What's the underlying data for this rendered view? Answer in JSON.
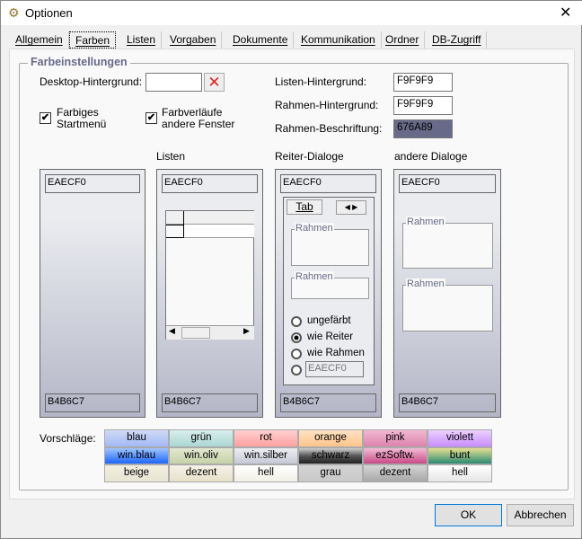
{
  "window": {
    "title": "Optionen",
    "close": "✕"
  },
  "tabs": [
    "Allgemein",
    "Farben",
    "Listen",
    "Vorgaben",
    "Dokumente",
    "Kommunikation",
    "Ordner",
    "DB-Zugriff"
  ],
  "group": {
    "title": "Farbeinstellungen"
  },
  "desktop": {
    "label": "Desktop-Hintergrund:",
    "value": "",
    "clear": "✕"
  },
  "checks": {
    "colored_start": "Farbiges Startmenü",
    "gradients": "Farbverläufe andere Fenster"
  },
  "listen_bg": {
    "label": "Listen-Hintergrund:",
    "value": "F9F9F9"
  },
  "rahmen_bg": {
    "label": "Rahmen-Hintergrund:",
    "value": "F9F9F9"
  },
  "rahmen_caption": {
    "label": "Rahmen-Beschriftung:",
    "value": "676A89",
    "color": "#676A89"
  },
  "columns": {
    "listen": "Listen",
    "reiter": "Reiter-Dialoge",
    "andere": "andere Dialoge",
    "top": "EAECF0",
    "bottom": "B4B6C7"
  },
  "preview": {
    "tab": "Tab",
    "frame": "Rahmen",
    "radios": [
      "ungefärbt",
      "wie Reiter",
      "wie Rahmen"
    ],
    "custom": "EAECF0"
  },
  "suggestions": {
    "label": "Vorschläge:",
    "items": [
      [
        "blau",
        "#cfdaf5",
        "#a3b8f5"
      ],
      [
        "grün",
        "#d9efed",
        "#aad7d2"
      ],
      [
        "rot",
        "#ffd0d0",
        "#ffa0a0"
      ],
      [
        "orange",
        "#ffe2c4",
        "#ffc48a"
      ],
      [
        "pink",
        "#f2b8d2",
        "#dc82ad"
      ],
      [
        "violett",
        "#ecd2ff",
        "#c88cff"
      ],
      [
        "win.blau",
        "#9fc4ff",
        "#1c66ff"
      ],
      [
        "win.oliv",
        "#e2e8d0",
        "#c6d2a8"
      ],
      [
        "win.silber",
        "#eeeef2",
        "#c6c8d6"
      ],
      [
        "schwarz",
        "#d0d0d0",
        "#222222"
      ],
      [
        "ezSoftw.",
        "#f2bcd4",
        "#c84a86"
      ],
      [
        "bunt",
        "#e6e090",
        "#2a8a74"
      ],
      [
        "beige",
        "#f2efe0",
        "#e8e4d2"
      ],
      [
        "dezent",
        "#f6f2e6",
        "#e6dfc8"
      ],
      [
        "hell",
        "#ffffff",
        "#f2f0e6"
      ],
      [
        "grau",
        "#d4d4d4",
        "#c8c8c8"
      ],
      [
        "dezent",
        "#d4d4d4",
        "#a8a8a8"
      ],
      [
        "hell",
        "#ffffff",
        "#e6e6e6"
      ]
    ]
  },
  "buttons": {
    "ok": "OK",
    "cancel": "Abbrechen"
  }
}
